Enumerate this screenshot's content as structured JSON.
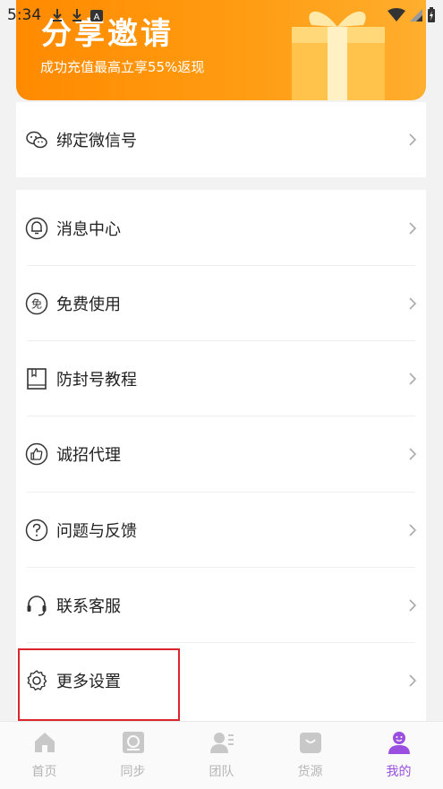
{
  "status_bar": {
    "time": "5:34",
    "icons_left": [
      "download-icon",
      "download-icon",
      "a-badge-icon"
    ],
    "icons_right": [
      "wifi-icon",
      "signal-icon",
      "battery-charging-icon"
    ]
  },
  "banner": {
    "title": "分享邀请",
    "subtitle": "成功充值最高立享55%返现",
    "gradient": [
      "#ff8a00",
      "#ffae2e"
    ]
  },
  "wechat_section": {
    "label": "绑定微信号",
    "icon": "wechat-icon"
  },
  "menu": [
    {
      "label": "消息中心",
      "icon": "bell-icon"
    },
    {
      "label": "免费使用",
      "icon": "free-icon"
    },
    {
      "label": "防封号教程",
      "icon": "book-icon"
    },
    {
      "label": "诚招代理",
      "icon": "thumbs-up-icon"
    },
    {
      "label": "问题与反馈",
      "icon": "question-icon"
    },
    {
      "label": "联系客服",
      "icon": "headset-icon"
    },
    {
      "label": "更多设置",
      "icon": "gear-icon"
    }
  ],
  "tabbar": {
    "tabs": [
      {
        "label": "首页",
        "icon": "home-icon"
      },
      {
        "label": "同步",
        "icon": "sync-icon"
      },
      {
        "label": "团队",
        "icon": "team-icon"
      },
      {
        "label": "货源",
        "icon": "bag-icon"
      },
      {
        "label": "我的",
        "icon": "profile-icon"
      }
    ],
    "active_index": 4,
    "active_color": "#9a4fe0",
    "inactive_color": "#b5b5b5"
  }
}
